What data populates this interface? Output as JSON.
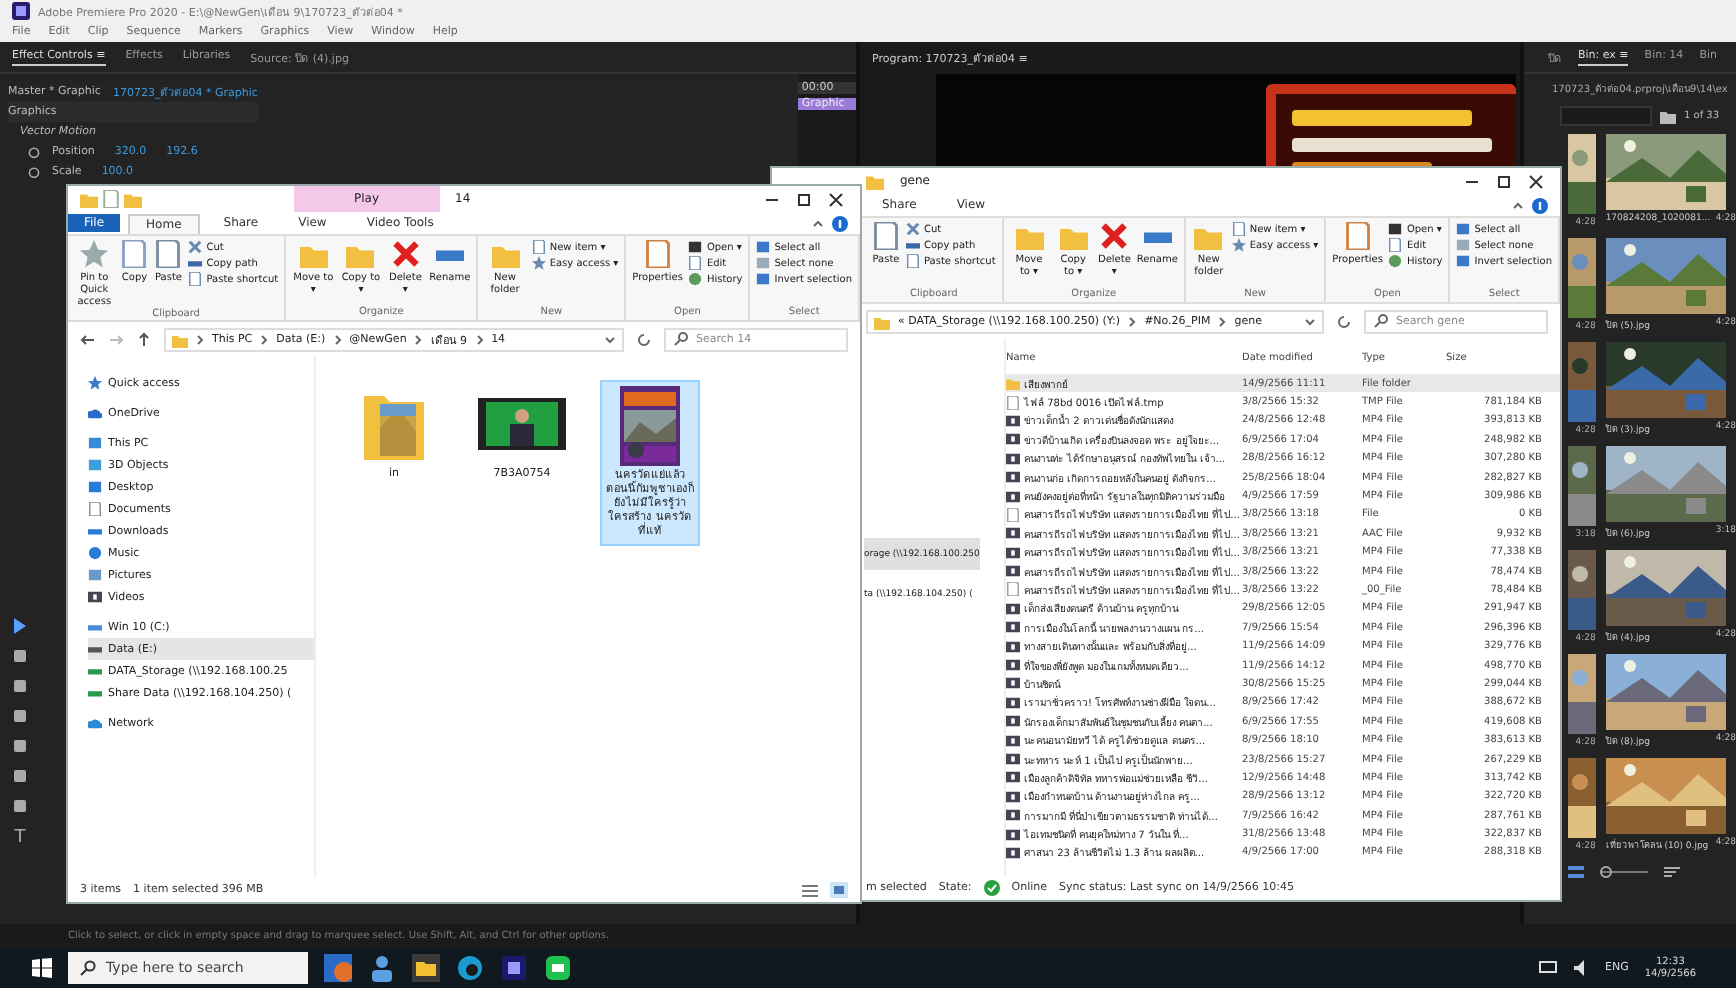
{
  "premiere": {
    "title": "Adobe Premiere Pro 2020 - E:\\@NewGen\\เดือน 9\\170723_ตัวต่อ04 *",
    "menu": [
      "File",
      "Edit",
      "Clip",
      "Sequence",
      "Markers",
      "Graphics",
      "View",
      "Window",
      "Help"
    ],
    "panel_tabs": [
      {
        "label": "Effect Controls ≡",
        "selected": true
      },
      {
        "label": "Effects",
        "selected": false
      },
      {
        "label": "Libraries",
        "selected": false
      },
      {
        "label": "Source: ปิด (4).jpg",
        "selected": false
      }
    ],
    "type_tool": "T",
    "clip_master": "Master * Graphic",
    "clip_sequence": "170723_ตัวต่อ04 * Graphic",
    "timecode": "00:00",
    "timeline_clip": "Graphic",
    "section": "Graphics",
    "effect": "Vector Motion",
    "properties": [
      {
        "label": "Position",
        "values": [
          "320.0",
          "192.6"
        ]
      },
      {
        "label": "Scale",
        "values": [
          "100.0"
        ]
      }
    ],
    "program_tab": "Program: 170723_ตัวต่อ04 ≡",
    "status": "Click to select, or click in empty space and drag to marquee select. Use Shift, Alt, and Ctrl for other options."
  },
  "project": {
    "tabs": [
      {
        "label": "ปิด",
        "selected": false
      },
      {
        "label": "Bin: ex ≡",
        "selected": true
      },
      {
        "label": "Bin: 14",
        "selected": false
      },
      {
        "label": "Bin",
        "selected": false
      }
    ],
    "path": "170723_ตัวต่อ04.prproj\\เดือน9\\14\\ex",
    "count": "1 of 33",
    "side_durations": [
      "4:28",
      "4:28",
      "4:28",
      "3:18",
      "4:28",
      "4:28",
      "4:28"
    ],
    "items": [
      {
        "name": "170824208_1020081...",
        "duration": "4:28"
      },
      {
        "name": "ปิด (5).jpg",
        "duration": "4:28"
      },
      {
        "name": "ปิด (3).jpg",
        "duration": "4:28"
      },
      {
        "name": "ปิด (6).jpg",
        "duration": "3:18"
      },
      {
        "name": "ปิด (4).jpg",
        "duration": "4:28"
      },
      {
        "name": "ปิด (8).jpg",
        "duration": "4:28"
      },
      {
        "name": "เที่ยวพาโคลน (10) 0.jpg",
        "duration": "4:28"
      }
    ]
  },
  "explorer_front": {
    "title": "14",
    "context_tab": "Play",
    "tabs": [
      {
        "label": "File",
        "selected": false
      },
      {
        "label": "Home",
        "selected": true
      },
      {
        "label": "Share",
        "selected": false
      },
      {
        "label": "View",
        "selected": false
      },
      {
        "label": "Video Tools",
        "selected": false
      }
    ],
    "ribbon": [
      {
        "label": "Clipboard",
        "big": [
          "Pin to Quick access",
          "Copy",
          "Paste"
        ],
        "small": [
          "Cut",
          "Copy path",
          "Paste shortcut"
        ]
      },
      {
        "label": "Organize",
        "big": [
          "Move to ▾",
          "Copy to ▾",
          "Delete ▾",
          "Rename"
        ]
      },
      {
        "label": "New",
        "big": [
          "New folder"
        ],
        "small": [
          "New item ▾",
          "Easy access ▾"
        ]
      },
      {
        "label": "Open",
        "big": [
          "Properties"
        ],
        "small": [
          "Open ▾",
          "Edit",
          "History"
        ]
      },
      {
        "label": "Select",
        "small": [
          "Select all",
          "Select none",
          "Invert selection"
        ]
      }
    ],
    "address": [
      "This PC",
      "Data (E:)",
      "@NewGen",
      "เดือน 9",
      "14"
    ],
    "search": "Search 14",
    "nav": [
      {
        "label": "Quick access",
        "selected": false
      },
      {
        "label": "OneDrive",
        "selected": false
      },
      {
        "label": "This PC",
        "selected": false
      },
      {
        "label": "3D Objects",
        "selected": false
      },
      {
        "label": "Desktop",
        "selected": false
      },
      {
        "label": "Documents",
        "selected": false
      },
      {
        "label": "Downloads",
        "selected": false
      },
      {
        "label": "Music",
        "selected": false
      },
      {
        "label": "Pictures",
        "selected": false
      },
      {
        "label": "Videos",
        "selected": false
      },
      {
        "label": "Win 10 (C:)",
        "selected": false
      },
      {
        "label": "Data (E:)",
        "selected": true
      },
      {
        "label": "DATA_Storage (\\\\192.168.100.25",
        "selected": false
      },
      {
        "label": "Share Data (\\\\192.168.104.250) (",
        "selected": false
      },
      {
        "label": "Network",
        "selected": false
      }
    ],
    "files": [
      {
        "name": "in",
        "kind": "folder",
        "selected": false
      },
      {
        "name": "7B3A0754",
        "kind": "video",
        "selected": false
      },
      {
        "name": "นครวัดแย่แล้ว ตอนนี้กัมพูชาเองก็ ยังไม่มีใครรู้ว่าใครสร้าง นครวัดที่แท้",
        "selected": true
      }
    ],
    "status": [
      "3 items",
      "1 item selected 396 MB"
    ]
  },
  "explorer_back": {
    "title": "gene",
    "tabs": [
      {
        "label": "Share",
        "selected": false
      },
      {
        "label": "View",
        "selected": false
      }
    ],
    "ribbon": [
      {
        "label": "Clipboard",
        "big": [
          "Paste"
        ],
        "small": [
          "Cut",
          "Copy path",
          "Paste shortcut"
        ]
      },
      {
        "label": "Organize",
        "big": [
          "Move to ▾",
          "Copy to ▾",
          "Delete ▾",
          "Rename"
        ]
      },
      {
        "label": "New",
        "big": [
          "New folder"
        ],
        "small": [
          "New item ▾",
          "Easy access ▾"
        ]
      },
      {
        "label": "Open",
        "big": [
          "Properties"
        ],
        "small": [
          "Open ▾",
          "Edit",
          "History"
        ]
      },
      {
        "label": "Select",
        "small": [
          "Select all",
          "Select none",
          "Invert selection"
        ]
      }
    ],
    "address": [
      "« DATA_Storage (\\\\192.168.100.250) (Y:)",
      "#No.26_PIM",
      "gene"
    ],
    "search": "Search gene",
    "nav": [
      {
        "label": "orage (\\\\192.168.100.250",
        "selected": true
      },
      {
        "label": "ta (\\\\192.168.104.250) (",
        "selected": false
      }
    ],
    "columns": [
      "Name",
      "Date modified",
      "Type",
      "Size"
    ],
    "rows": [
      {
        "name": "เสียงพากย์",
        "date": "14/9/2566 11:11",
        "type": "File folder",
        "size": "",
        "kind": "folder",
        "selected": true
      },
      {
        "name": "ไฟล์ 78bd 0016 เปิดไฟล์.tmp",
        "date": "3/8/2566 15:32",
        "type": "TMP File",
        "size": "781,184 KB",
        "kind": "file",
        "selected": false
      },
      {
        "name": "ข่าวเด็กน้ำ 2 ดาวเด่นชื่อดังนักแสดง",
        "date": "24/8/2566 12:48",
        "type": "MP4 File",
        "size": "393,813 KB",
        "kind": "video",
        "selected": false
      },
      {
        "name": "ข่าวดีบ้านเกิด เครื่องบินลงจอด พระ อยู่ใจยะ...",
        "date": "6/9/2566 17:04",
        "type": "MP4 File",
        "size": "248,982 KB",
        "kind": "video",
        "selected": false
      },
      {
        "name": "คนงานท่ะ ได้รักษาอนุสรณ์ กองทัพไทยใน เจ้า...",
        "date": "28/8/2566 16:12",
        "type": "MP4 File",
        "size": "307,280 KB",
        "kind": "video",
        "selected": false
      },
      {
        "name": "คนงานก่อ เกิดการถอยหลังในคนอยู่ ดังกิจกร...",
        "date": "25/8/2566 18:04",
        "type": "MP4 File",
        "size": "282,827 KB",
        "kind": "video",
        "selected": false
      },
      {
        "name": "คนยังคงอยู่ต่อที่หน้า รัฐบาลในทุกมิติความร่วมมือ",
        "date": "4/9/2566 17:59",
        "type": "MP4 File",
        "size": "309,986 KB",
        "kind": "video",
        "selected": false
      },
      {
        "name": "คนสารถีรถไฟบริษัท แสดงรายการเมืองไทย ที่ไป...",
        "date": "3/8/2566 13:18",
        "type": "File",
        "size": "0 KB",
        "kind": "file",
        "selected": false
      },
      {
        "name": "คนสารถีรถไฟบริษัท แสดงรายการเมืองไทย ที่ไป...",
        "date": "3/8/2566 13:21",
        "type": "AAC File",
        "size": "9,932 KB",
        "kind": "video",
        "selected": false
      },
      {
        "name": "คนสารถีรถไฟบริษัท แสดงรายการเมืองไทย ที่ไป...",
        "date": "3/8/2566 13:21",
        "type": "MP4 File",
        "size": "77,338 KB",
        "kind": "video",
        "selected": false
      },
      {
        "name": "คนสารถีรถไฟบริษัท แสดงรายการเมืองไทย ที่ไป...",
        "date": "3/8/2566 13:22",
        "type": "MP4 File",
        "size": "78,474 KB",
        "kind": "video",
        "selected": false
      },
      {
        "name": "คนสารถีรถไฟบริษัท แสดงรายการเมืองไทย ที่ไป...",
        "date": "3/8/2566 13:22",
        "type": "_00_File",
        "size": "78,484 KB",
        "kind": "file",
        "selected": false
      },
      {
        "name": "เด็กส่งเสียงดนตรี ด้านบ้าน ครูทุกบ้าน",
        "date": "29/8/2566 12:05",
        "type": "MP4 File",
        "size": "291,947 KB",
        "kind": "video",
        "selected": false
      },
      {
        "name": "การเมืองในโลกนี้ นายพลงานวางแผน กร...",
        "date": "7/9/2566 15:54",
        "type": "MP4 File",
        "size": "296,396 KB",
        "kind": "video",
        "selected": false
      },
      {
        "name": "ทางสายเดินทางนั้นและ พร้อมกับสิ่งที่อยู่...",
        "date": "11/9/2566 14:09",
        "type": "MP4 File",
        "size": "329,776 KB",
        "kind": "video",
        "selected": false
      },
      {
        "name": "ที่ใจของพี่ยังพูด มองในเกมทั้งหมดเดียว...",
        "date": "11/9/2566 14:12",
        "type": "MP4 File",
        "size": "498,770 KB",
        "kind": "video",
        "selected": false
      },
      {
        "name": "บ้านชิดน์",
        "date": "30/8/2566 15:25",
        "type": "MP4 File",
        "size": "299,044 KB",
        "kind": "video",
        "selected": false
      },
      {
        "name": "เรามาชั่วคราว! โทรศัพท์งานช่างฝีมือ ใจดน...",
        "date": "8/9/2566 17:42",
        "type": "MP4 File",
        "size": "388,672 KB",
        "kind": "video",
        "selected": false
      },
      {
        "name": "นักรองเด็กมาสัมพันธ์ในชุมชนกับเลี้ยง คนตา...",
        "date": "6/9/2566 17:55",
        "type": "MP4 File",
        "size": "419,608 KB",
        "kind": "video",
        "selected": false
      },
      {
        "name": "นะคนอนามัยทวี ได้ ครูได้ช่วยดูแล ดนตร...",
        "date": "8/9/2566 18:10",
        "type": "MP4 File",
        "size": "383,613 KB",
        "kind": "video",
        "selected": false
      },
      {
        "name": "นะทหาร นะห์ 1 เป็นไป ครูเป็นนักพาย...",
        "date": "23/8/2566 15:27",
        "type": "MP4 File",
        "size": "267,229 KB",
        "kind": "video",
        "selected": false
      },
      {
        "name": "เมืองลูกค้าดิจิทัล ทหารพ่อแม่ช่วยเหลือ ชีวิ...",
        "date": "12/9/2566 14:48",
        "type": "MP4 File",
        "size": "313,742 KB",
        "kind": "video",
        "selected": false
      },
      {
        "name": "เมืองกำหนดบ้าน ด้านงานอยู่ห่างไกล ครู...",
        "date": "28/9/2566 13:12",
        "type": "MP4 File",
        "size": "322,720 KB",
        "kind": "video",
        "selected": false
      },
      {
        "name": "การมากมี ที่นี่ป่าเขียวตามธรรมชาติ ท่านได้...",
        "date": "7/9/2566 16:42",
        "type": "MP4 File",
        "size": "287,761 KB",
        "kind": "video",
        "selected": false
      },
      {
        "name": "ไอเทมชนิดที่ คนยุคใหม่ทาง 7 วันใน ที่...",
        "date": "31/8/2566 13:48",
        "type": "MP4 File",
        "size": "322,837 KB",
        "kind": "video",
        "selected": false
      },
      {
        "name": "ศาสนา 23 ล้านชีวิตไม่ 1.3 ล้าน ผลผลิต...",
        "date": "4/9/2566 17:00",
        "type": "MP4 File",
        "size": "288,318 KB",
        "kind": "video",
        "selected": false
      }
    ],
    "status": [
      "m selected",
      "State:",
      "Online",
      "Sync status: Last sync on 14/9/2566 10:45"
    ]
  },
  "taskbar": {
    "search": "Type here to search",
    "language": "ENG",
    "time": "12:33",
    "date": "14/9/2566"
  }
}
